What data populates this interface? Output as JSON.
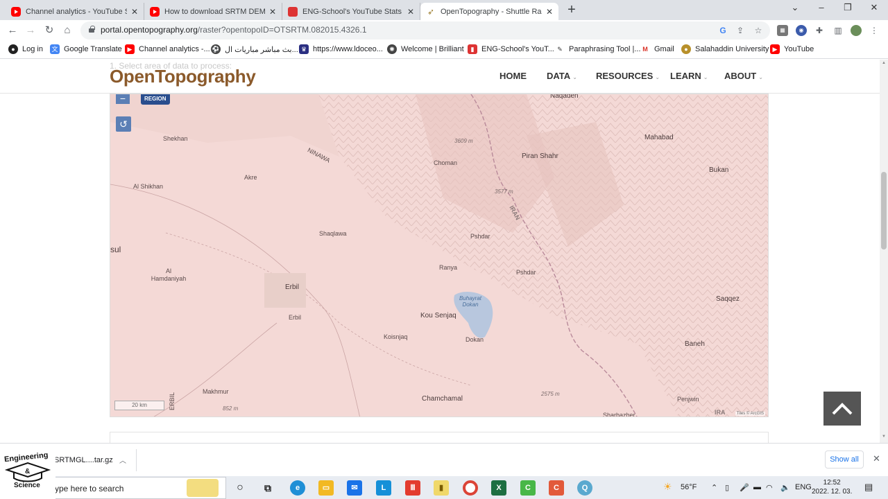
{
  "browser": {
    "tabs": [
      {
        "title": "Channel analytics - YouTube Studio",
        "icon": "youtube-icon"
      },
      {
        "title": "How to download SRTM DEM from",
        "icon": "youtube-icon"
      },
      {
        "title": "ENG-School's YouTube Stats (Sum",
        "icon": "stats-icon"
      },
      {
        "title": "OpenTopography - Shuttle Radar",
        "icon": "opentopography-icon",
        "active": true
      }
    ],
    "url_host": "portal.opentopography.org",
    "url_path": "/raster?opentopoID=OTSRTM.082015.4326.1",
    "bookmarks": [
      "Log in",
      "Google Translate",
      "Channel analytics -...",
      "بث مباشر مباريات ال...",
      "https://www.ldoceo...",
      "Welcome | Brilliant",
      "ENG-School's YouT...",
      "Paraphrasing Tool |...",
      "Gmail",
      "Salahaddin University",
      "YouTube"
    ]
  },
  "site": {
    "logo": "OpenTopography",
    "ghost_heading": "1. Select area of data to process:",
    "nav": [
      "HOME",
      "DATA",
      "RESOURCES",
      "LEARN",
      "ABOUT"
    ]
  },
  "map": {
    "zoom_out": "−",
    "region_button": "REGION",
    "reset_symbol": "↺",
    "scale": "20 km",
    "attribution": "Tiles © ArcGIS",
    "labels": [
      {
        "text": "Naqadeh",
        "kind": "big"
      },
      {
        "text": "Shekhan",
        "kind": "normal"
      },
      {
        "text": "3609 m",
        "kind": "alt"
      },
      {
        "text": "Mahabad",
        "kind": "big"
      },
      {
        "text": "Piran Shahr",
        "kind": "big"
      },
      {
        "text": "NINAWA",
        "kind": "normal"
      },
      {
        "text": "Choman",
        "kind": "normal"
      },
      {
        "text": "Bukan",
        "kind": "big"
      },
      {
        "text": "Akre",
        "kind": "normal"
      },
      {
        "text": "Al Shikhan",
        "kind": "normal"
      },
      {
        "text": "3577 m",
        "kind": "alt"
      },
      {
        "text": "IRAN",
        "kind": "country"
      },
      {
        "text": "Shaqlawa",
        "kind": "normal"
      },
      {
        "text": "Pshdar",
        "kind": "normal"
      },
      {
        "text": "sul",
        "kind": "big"
      },
      {
        "text": "Ranya",
        "kind": "normal"
      },
      {
        "text": "Al Hamdaniyah",
        "kind": "normal"
      },
      {
        "text": "Pshdar",
        "kind": "normal"
      },
      {
        "text": "Erbil",
        "kind": "big"
      },
      {
        "text": "Buhayrat Dokan",
        "kind": "water"
      },
      {
        "text": "Saqqez",
        "kind": "big"
      },
      {
        "text": "Erbil",
        "kind": "normal"
      },
      {
        "text": "Kou Senjaq",
        "kind": "big"
      },
      {
        "text": "Koisnjaq",
        "kind": "normal"
      },
      {
        "text": "Dokan",
        "kind": "normal"
      },
      {
        "text": "Baneh",
        "kind": "big"
      },
      {
        "text": "Makhmur",
        "kind": "normal"
      },
      {
        "text": "ERBIL",
        "kind": "normal"
      },
      {
        "text": "2575 m",
        "kind": "alt"
      },
      {
        "text": "852 m",
        "kind": "alt"
      },
      {
        "text": "Chamchamal",
        "kind": "big"
      },
      {
        "text": "Penjwin",
        "kind": "normal"
      },
      {
        "text": "Sharbazher",
        "kind": "normal"
      },
      {
        "text": "IRA",
        "kind": "country"
      }
    ]
  },
  "downloads": {
    "file": "SRTMGL....tar.gz",
    "show_all": "Show all"
  },
  "watermark": {
    "line1": "Engineering",
    "line2": "Science",
    "amp": "&"
  },
  "taskbar": {
    "search_placeholder": "ype here to search",
    "weather": "56°F",
    "lang": "ENG",
    "time": "12:52",
    "date": "2022. 12. 03."
  }
}
